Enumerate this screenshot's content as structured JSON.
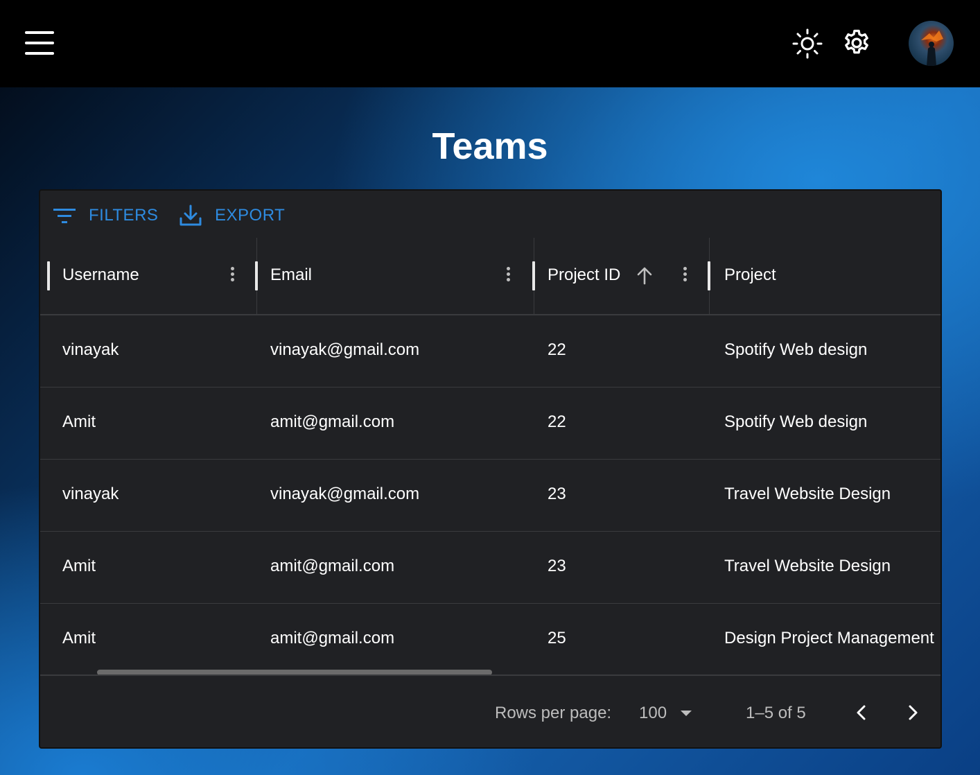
{
  "topbar": {
    "menu_icon": "menu-icon",
    "theme_icon": "sun-icon",
    "settings_icon": "gear-icon",
    "avatar": "avatar"
  },
  "page": {
    "title": "Teams"
  },
  "toolbar": {
    "filters_label": "FILTERS",
    "export_label": "EXPORT"
  },
  "columns": {
    "username": "Username",
    "email": "Email",
    "project_id": "Project ID",
    "project": "Project"
  },
  "rows": [
    {
      "username": "vinayak",
      "email": "vinayak@gmail.com",
      "project_id": "22",
      "project": "Spotify Web design"
    },
    {
      "username": "Amit",
      "email": "amit@gmail.com",
      "project_id": "22",
      "project": "Spotify Web design"
    },
    {
      "username": "vinayak",
      "email": "vinayak@gmail.com",
      "project_id": "23",
      "project": "Travel Website Design"
    },
    {
      "username": "Amit",
      "email": "amit@gmail.com",
      "project_id": "23",
      "project": "Travel Website Design"
    },
    {
      "username": "Amit",
      "email": "amit@gmail.com",
      "project_id": "25",
      "project": "Design Project Management"
    }
  ],
  "pagination": {
    "rows_per_page_label": "Rows per page:",
    "rows_per_page_value": "100",
    "range": "1–5 of 5"
  },
  "colors": {
    "accent": "#2e8be0",
    "grid_bg": "#202124",
    "topbar_bg": "#000000"
  }
}
